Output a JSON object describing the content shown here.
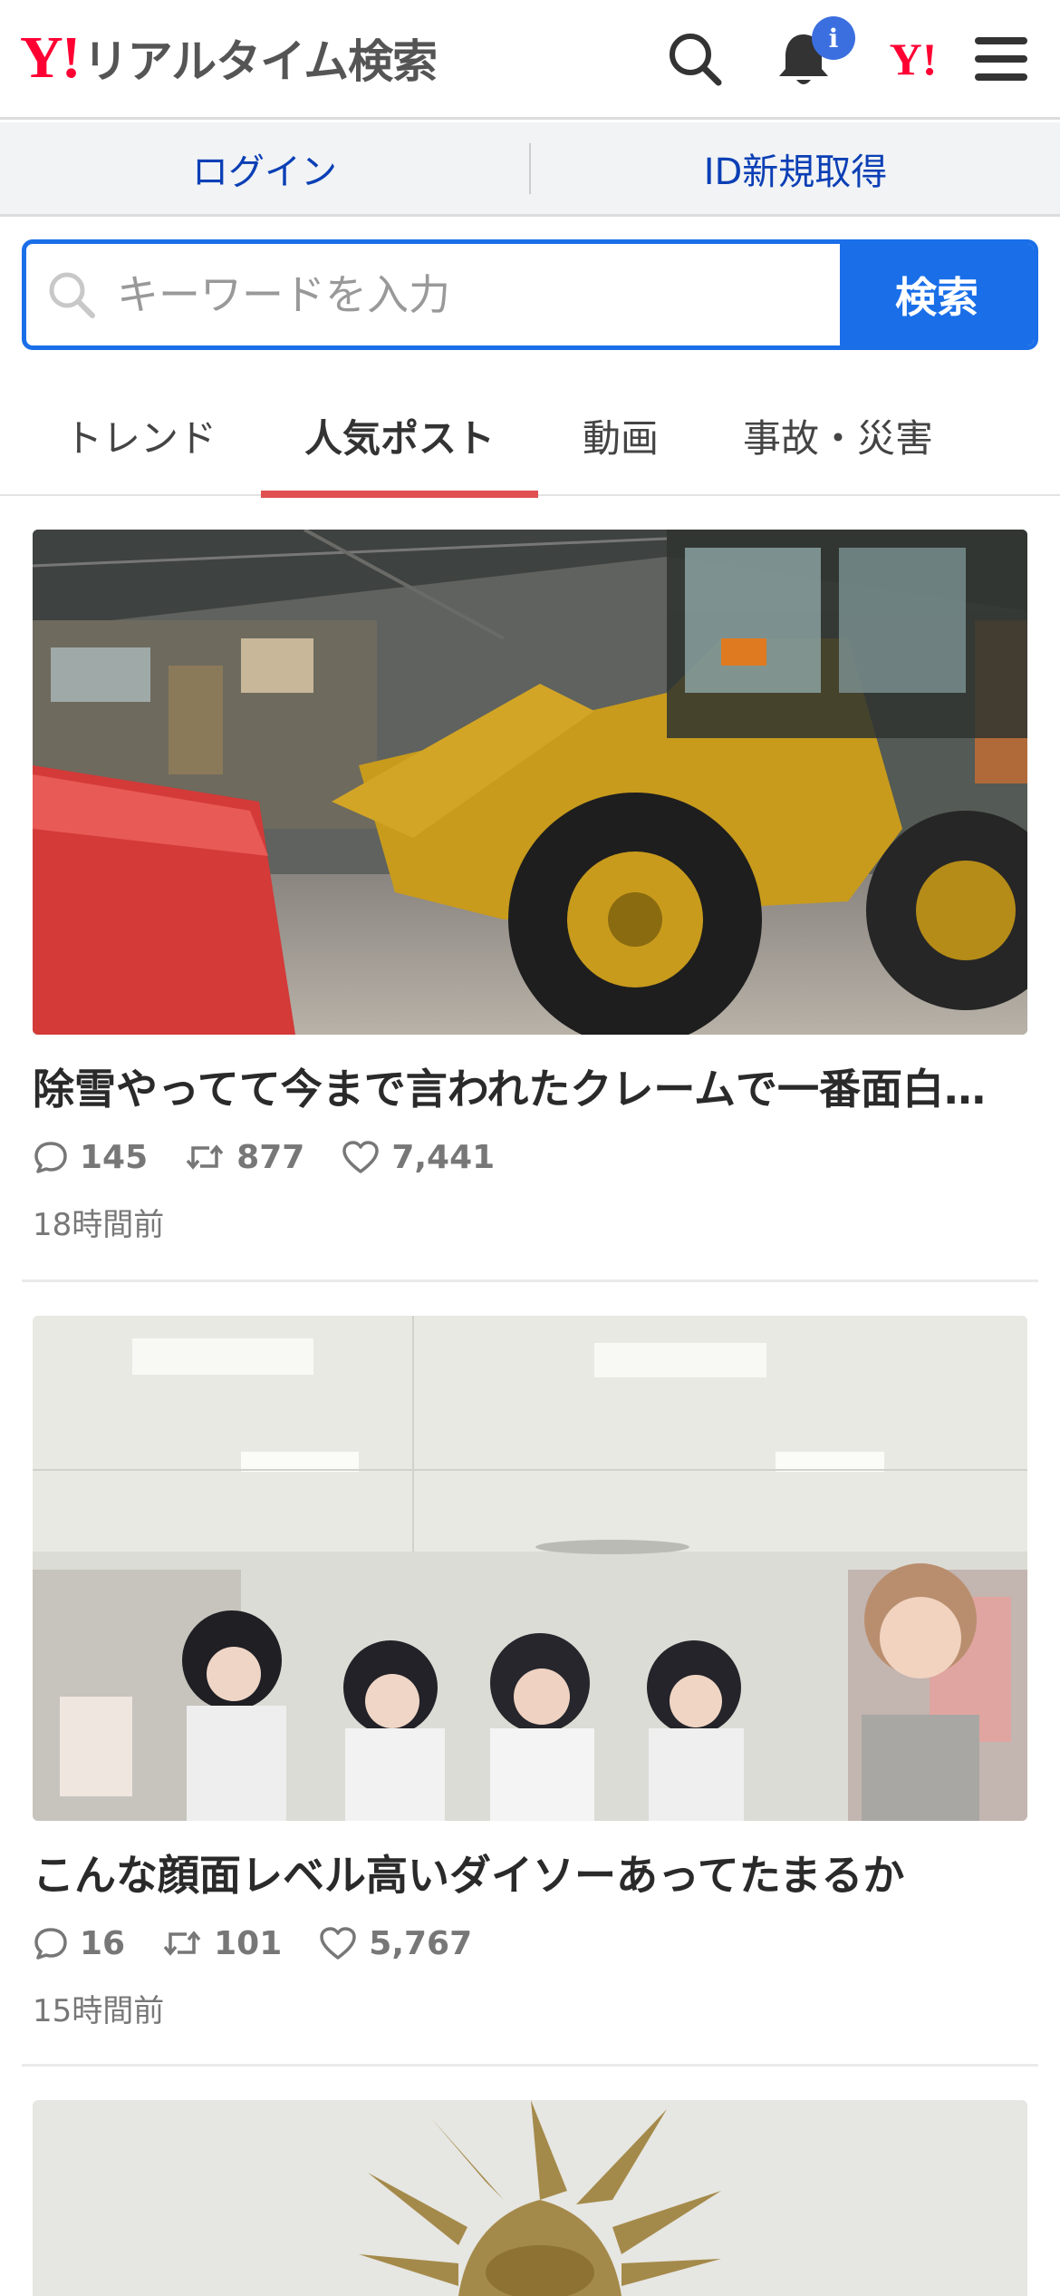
{
  "header": {
    "logo_mark": "Y!",
    "logo_text": "リアルタイム検索",
    "notification_badge": "i",
    "yahoo_mark": "Y!"
  },
  "account": {
    "login_label": "ログイン",
    "signup_label": "ID新規取得"
  },
  "search": {
    "placeholder": "キーワードを入力",
    "button_label": "検索"
  },
  "tabs": [
    {
      "label": "トレンド",
      "active": false
    },
    {
      "label": "人気ポスト",
      "active": true
    },
    {
      "label": "動画",
      "active": false
    },
    {
      "label": "事故・災害",
      "active": false
    }
  ],
  "posts": [
    {
      "title": "除雪やってて今まで言われたクレームで一番面白いの",
      "replies": "145",
      "reposts": "877",
      "likes": "7,441",
      "time": "18時間前"
    },
    {
      "title": "こんな顔面レベル高いダイソーあってたまるか",
      "replies": "16",
      "reposts": "101",
      "likes": "5,767",
      "time": "15時間前"
    }
  ],
  "colors": {
    "brand_red": "#ff0033",
    "accent_blue": "#1a6fe8",
    "tab_indicator": "#e05050",
    "link_blue": "#0b3fb5"
  }
}
